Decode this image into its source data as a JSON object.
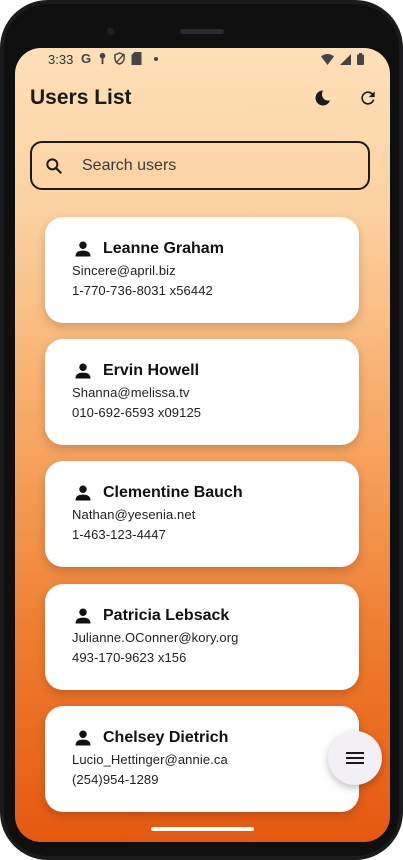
{
  "status_bar": {
    "time": "3:33",
    "left_icons": [
      "google-icon",
      "key-icon",
      "shield-icon",
      "sd-card-icon"
    ],
    "right_icons": [
      "wifi-icon",
      "cellular-icon",
      "battery-icon"
    ]
  },
  "appbar": {
    "title": "Users List",
    "theme_icon": "dark-mode-moon-icon",
    "refresh_icon": "refresh-icon"
  },
  "search": {
    "placeholder": "Search users",
    "value": ""
  },
  "users": [
    {
      "name": "Leanne Graham",
      "email": "Sincere@april.biz",
      "phone": "1-770-736-8031 x56442"
    },
    {
      "name": "Ervin Howell",
      "email": "Shanna@melissa.tv",
      "phone": "010-692-6593 x09125"
    },
    {
      "name": "Clementine Bauch",
      "email": "Nathan@yesenia.net",
      "phone": "1-463-123-4447"
    },
    {
      "name": "Patricia Lebsack",
      "email": "Julianne.OConner@kory.org",
      "phone": "493-170-9623 x156"
    },
    {
      "name": "Chelsey Dietrich",
      "email": "Lucio_Hettinger@annie.ca",
      "phone": "(254)954-1289"
    }
  ],
  "fab": {
    "icon": "menu-icon"
  },
  "colors": {
    "gradient_top": "#fde0b8",
    "gradient_bottom": "#e65810",
    "card": "#ffffff",
    "text": "#111111"
  }
}
